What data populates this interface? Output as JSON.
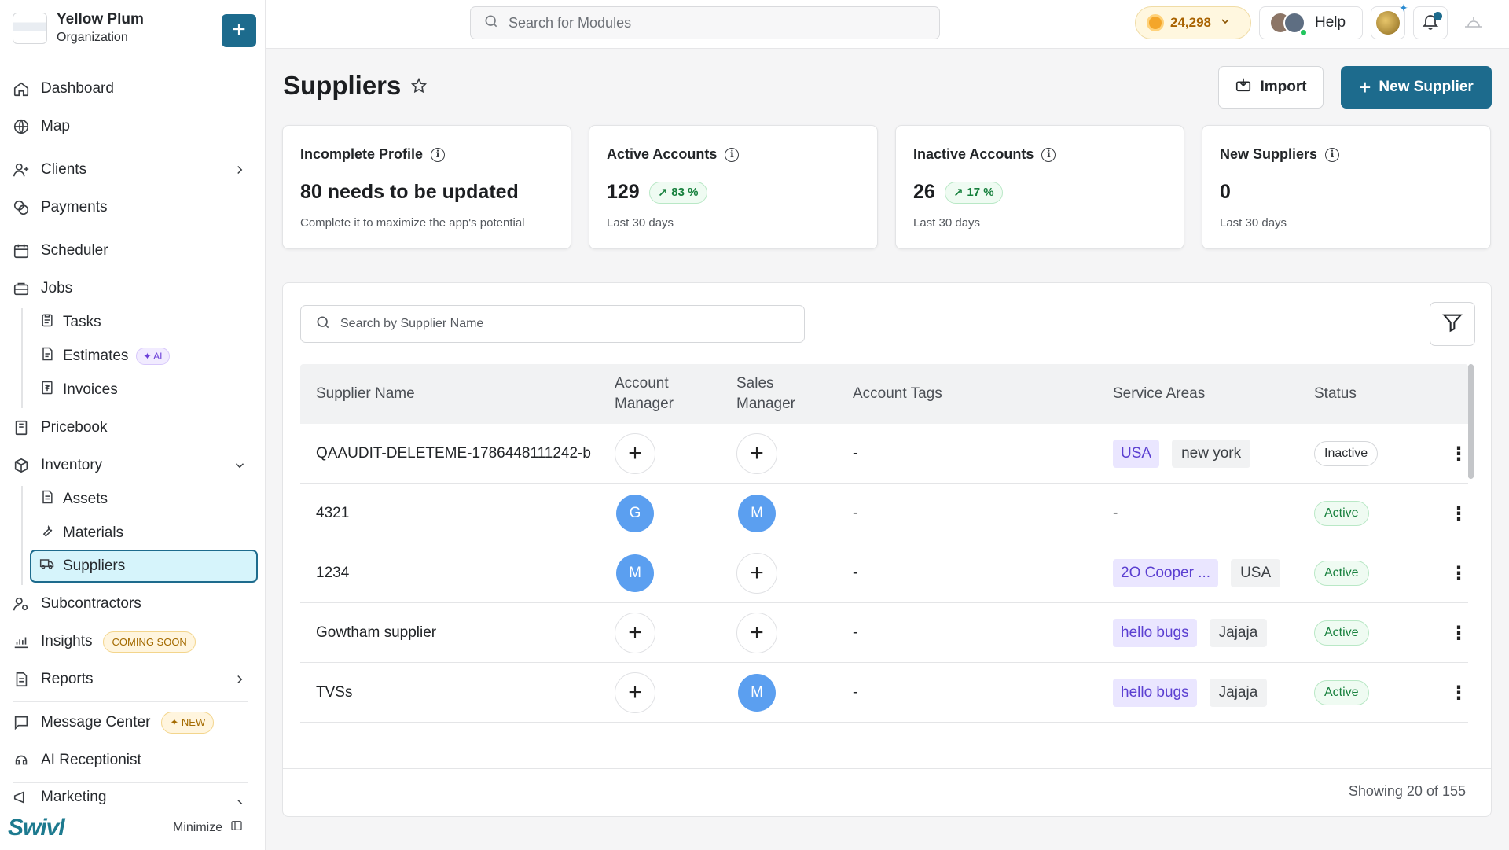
{
  "org": {
    "name": "Yellow Plum",
    "subtitle": "Organization",
    "add_label": "+"
  },
  "nav": {
    "dashboard": "Dashboard",
    "map": "Map",
    "clients": "Clients",
    "payments": "Payments",
    "scheduler": "Scheduler",
    "jobs": "Jobs",
    "tasks": "Tasks",
    "estimates": "Estimates",
    "estimates_badge": "AI",
    "invoices": "Invoices",
    "pricebook": "Pricebook",
    "inventory": "Inventory",
    "assets": "Assets",
    "materials": "Materials",
    "suppliers": "Suppliers",
    "subcontractors": "Subcontractors",
    "insights": "Insights",
    "insights_badge": "COMING SOON",
    "reports": "Reports",
    "message_center": "Message Center",
    "message_center_badge": "NEW",
    "ai_receptionist": "AI Receptionist",
    "marketing": "Marketing"
  },
  "sidebar_footer": {
    "brand": "Swivl",
    "minimize": "Minimize"
  },
  "topbar": {
    "search_placeholder": "Search for Modules",
    "coins": "24,298",
    "help": "Help"
  },
  "header": {
    "title": "Suppliers",
    "import_label": "Import",
    "new_label": "New Supplier"
  },
  "cards": [
    {
      "title": "Incomplete Profile",
      "value": "80 needs to be updated",
      "trend": "",
      "sub": "Complete it to maximize the app's potential"
    },
    {
      "title": "Active Accounts",
      "value": "129",
      "trend": "83 %",
      "sub": "Last 30 days"
    },
    {
      "title": "Inactive Accounts",
      "value": "26",
      "trend": "17 %",
      "sub": "Last 30 days"
    },
    {
      "title": "New Suppliers",
      "value": "0",
      "trend": "",
      "sub": "Last 30 days"
    }
  ],
  "table": {
    "search_placeholder": "Search by Supplier Name",
    "columns": [
      "Supplier Name",
      "Account Manager",
      "Sales Manager",
      "Account Tags",
      "Service Areas",
      "Status"
    ],
    "rows": [
      {
        "name": "QAAUDIT-DELETEME-1786448111242-b",
        "account_manager": "+",
        "sales_manager": "+",
        "tags": "-",
        "areas": [
          "USA",
          "new york"
        ],
        "status": "Inactive"
      },
      {
        "name": "4321",
        "account_manager": "G",
        "sales_manager": "M",
        "tags": "-",
        "areas": [
          "-"
        ],
        "status": "Active"
      },
      {
        "name": "1234",
        "account_manager": "M",
        "sales_manager": "+",
        "tags": "-",
        "areas": [
          "2O Cooper ...",
          "USA"
        ],
        "status": "Active"
      },
      {
        "name": "Gowtham supplier",
        "account_manager": "+",
        "sales_manager": "+",
        "tags": "-",
        "areas": [
          "hello bugs",
          "Jajaja"
        ],
        "status": "Active"
      },
      {
        "name": "TVSs",
        "account_manager": "+",
        "sales_manager": "M",
        "tags": "-",
        "areas": [
          "hello bugs",
          "Jajaja"
        ],
        "status": "Active"
      }
    ],
    "showing": "Showing 20 of 155"
  },
  "colors": {
    "accent": "#1d6b8d",
    "active_nav_bg": "#d6f4fb",
    "avatar_blue": "#5b9ff0",
    "active_status": "#17803d"
  }
}
